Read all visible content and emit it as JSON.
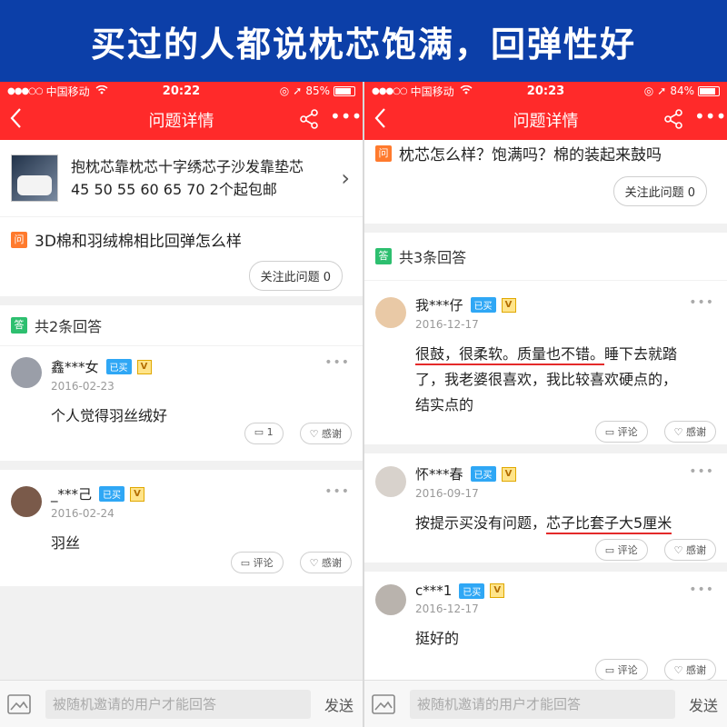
{
  "banner": {
    "text": "买过的人都说枕芯饱满，回弹性好"
  },
  "left": {
    "status": {
      "carrier": "中国移动",
      "time": "20:22",
      "battery": "85%",
      "battery_level": 0.85
    },
    "nav": {
      "title": "问题详情"
    },
    "product": {
      "line1": "抱枕芯靠枕芯十字绣芯子沙发靠垫芯",
      "line2": "45 50 55 60 65 70 2个起包邮"
    },
    "question": {
      "tag": "问",
      "text": "3D棉和羽绒棉相比回弹怎么样",
      "follow": "关注此问题 0"
    },
    "answers_header": {
      "tag": "答",
      "text": "共2条回答"
    },
    "answers": [
      {
        "user": "鑫***女",
        "bought": "已买",
        "level": "V",
        "date": "2016-02-23",
        "body": "个人觉得羽丝绒好",
        "comment": "1",
        "thanks": "感谢"
      },
      {
        "user": "_***己",
        "bought": "已买",
        "level": "V",
        "date": "2016-02-24",
        "body": "羽丝",
        "comment": "评论",
        "thanks": "感谢"
      }
    ],
    "bottom": {
      "placeholder": "被随机邀请的用户才能回答",
      "send": "发送"
    }
  },
  "right": {
    "status": {
      "carrier": "中国移动",
      "time": "20:23",
      "battery": "84%",
      "battery_level": 0.84
    },
    "nav": {
      "title": "问题详情"
    },
    "question": {
      "tag": "问",
      "text": "枕芯怎么样？饱满吗？棉的装起来鼓吗",
      "follow": "关注此问题 0"
    },
    "answers_header": {
      "tag": "答",
      "text": "共3条回答"
    },
    "answers": [
      {
        "user": "我***仔",
        "bought": "已买",
        "level": "V",
        "date": "2016-12-17",
        "body_hl": "很鼓，很柔软。质量也不错。",
        "body_rest1": "睡下去就踏",
        "body_line2": "了，我老婆很喜欢，我比较喜欢硬点的，",
        "body_line3": "结实点的",
        "comment": "评论",
        "thanks": "感谢"
      },
      {
        "user": "怀***春",
        "bought": "已买",
        "level": "V",
        "date": "2016-09-17",
        "body_pre": "按提示买没有问题，",
        "body_hl": "芯子比套子大5厘米",
        "comment": "评论",
        "thanks": "感谢"
      },
      {
        "user": "c***1",
        "bought": "已买",
        "level": "V",
        "date": "2016-12-17",
        "body": "挺好的",
        "comment": "评论",
        "thanks": "感谢"
      }
    ],
    "bottom": {
      "placeholder": "被随机邀请的用户才能回答",
      "send": "发送"
    }
  },
  "colors": {
    "banner": "#0c3fa8",
    "nav": "#ff2a2a",
    "bought_badge": "#2fa7f5",
    "q_tag": "#ff7a2d",
    "a_tag": "#2dbf6f",
    "highlight": "#e42a2a"
  }
}
